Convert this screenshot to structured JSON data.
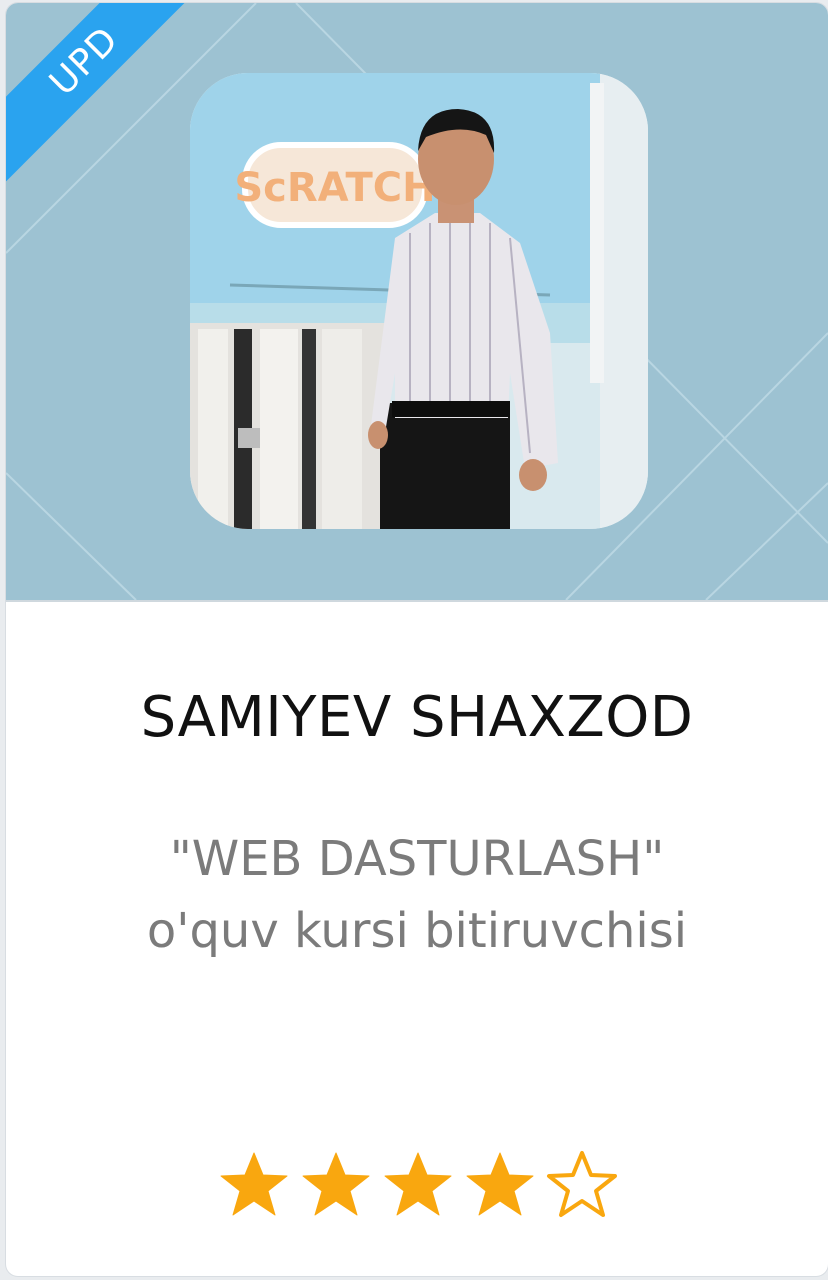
{
  "card": {
    "badge": "UPD",
    "photo_alt": "Graduate photo",
    "name": "SAMIYEV SHAXZOD",
    "subtitle_line1": "\"WEB DASTURLASH\"",
    "subtitle_line2": "o'quv kursi bitiruvchisi",
    "rating": {
      "value": 4,
      "max": 5
    }
  },
  "colors": {
    "hero_bg": "#9dc2d2",
    "badge_bg": "#2aa3ef",
    "star_fill": "#f9a70f",
    "name_text": "#111111",
    "subtitle_text": "#7b7b7b"
  },
  "icons": {
    "star_filled": "star-filled-icon",
    "star_empty": "star-outline-icon"
  }
}
